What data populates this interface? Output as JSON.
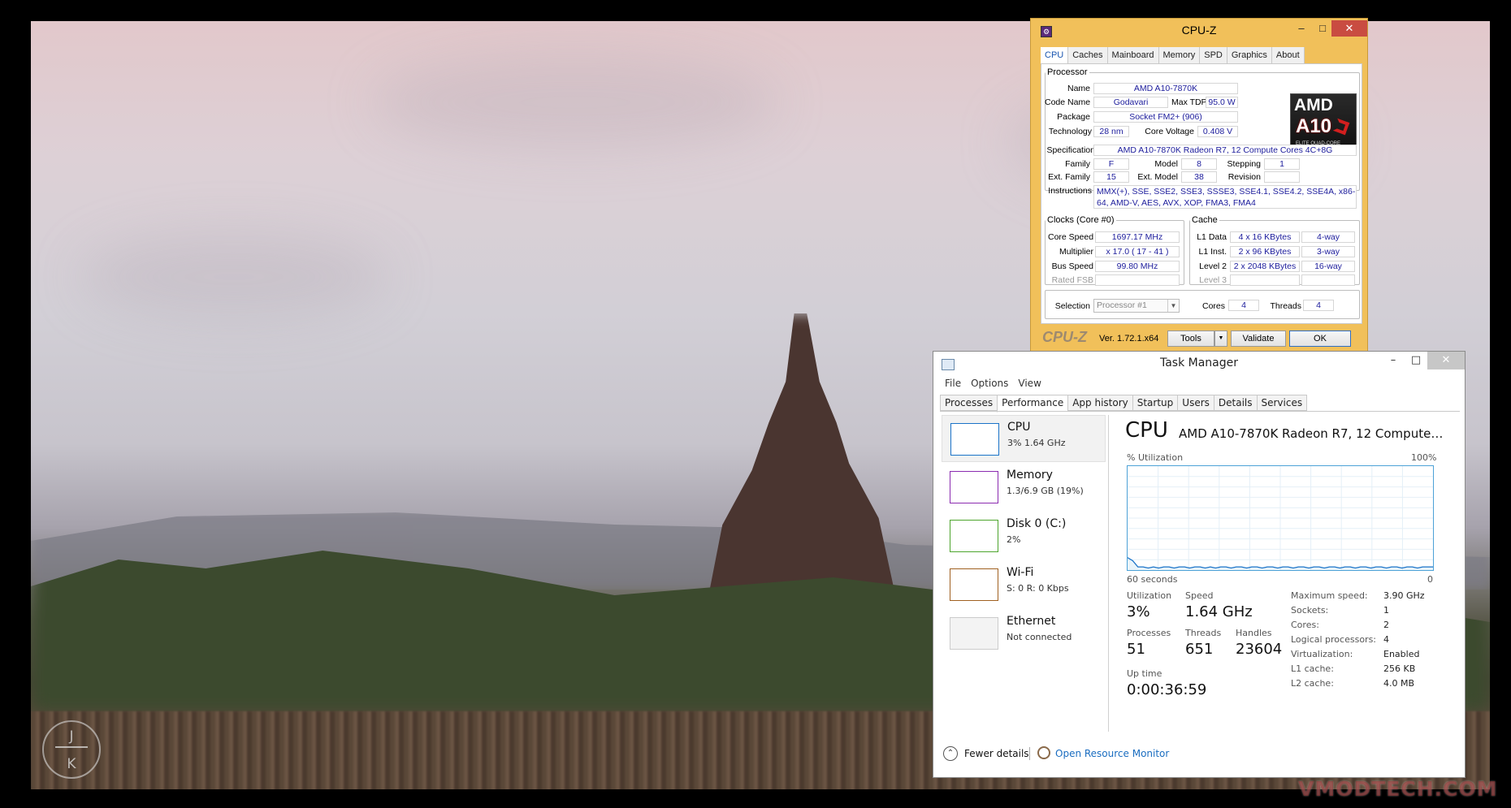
{
  "desktop": {
    "logo_line1": "J",
    "logo_line2": "K",
    "watermark": "VMODTECH.COM"
  },
  "cpuz": {
    "title": "CPU-Z",
    "window_controls": {
      "minimize": "–",
      "maximize": "□",
      "close": "✕"
    },
    "tabs": [
      "CPU",
      "Caches",
      "Mainboard",
      "Memory",
      "SPD",
      "Graphics",
      "About"
    ],
    "active_tab": "CPU",
    "processor": {
      "legend": "Processor",
      "name_label": "Name",
      "name": "AMD A10-7870K",
      "codename_label": "Code Name",
      "codename": "Godavari",
      "maxtdp_label": "Max TDP",
      "maxtdp": "95.0 W",
      "package_label": "Package",
      "package": "Socket FM2+ (906)",
      "technology_label": "Technology",
      "technology": "28 nm",
      "corevoltage_label": "Core Voltage",
      "corevoltage": "0.408 V",
      "specification_label": "Specification",
      "specification": "AMD A10-7870K Radeon R7, 12 Compute Cores 4C+8G",
      "family_label": "Family",
      "family": "F",
      "model_label": "Model",
      "model": "8",
      "stepping_label": "Stepping",
      "stepping": "1",
      "extfamily_label": "Ext. Family",
      "extfamily": "15",
      "extmodel_label": "Ext. Model",
      "extmodel": "38",
      "revision_label": "Revision",
      "revision": "",
      "instructions_label": "Instructions",
      "instructions": "MMX(+), SSE, SSE2, SSE3, SSSE3, SSE4.1, SSE4.2, SSE4A, x86-64, AMD-V, AES, AVX, XOP, FMA3, FMA4"
    },
    "amd_logo": {
      "brand": "AMD",
      "model": "A10",
      "sub": "ELITE QUAD-CORE"
    },
    "clocks": {
      "legend": "Clocks (Core #0)",
      "corespeed_label": "Core Speed",
      "corespeed": "1697.17 MHz",
      "multiplier_label": "Multiplier",
      "multiplier": "x 17.0 ( 17 - 41 )",
      "busspeed_label": "Bus Speed",
      "busspeed": "99.80 MHz",
      "ratedfsb_label": "Rated FSB",
      "ratedfsb": ""
    },
    "cache": {
      "legend": "Cache",
      "l1data_label": "L1 Data",
      "l1data": "4 x 16 KBytes",
      "l1data_way": "4-way",
      "l1inst_label": "L1 Inst.",
      "l1inst": "2 x 96 KBytes",
      "l1inst_way": "3-way",
      "level2_label": "Level 2",
      "level2": "2 x 2048 KBytes",
      "level2_way": "16-way",
      "level3_label": "Level 3",
      "level3": "",
      "level3_way": ""
    },
    "selection": {
      "selection_label": "Selection",
      "selection": "Processor #1",
      "cores_label": "Cores",
      "cores": "4",
      "threads_label": "Threads",
      "threads": "4"
    },
    "footer": {
      "brand": "CPU-Z",
      "version": "Ver. 1.72.1.x64",
      "tools": "Tools",
      "tools_arrow": "▼",
      "validate": "Validate",
      "ok": "OK"
    }
  },
  "taskmanager": {
    "title": "Task Manager",
    "window_controls": {
      "minimize": "–",
      "maximize": "□",
      "close": "✕"
    },
    "menu": [
      "File",
      "Options",
      "View"
    ],
    "tabs": [
      "Processes",
      "Performance",
      "App history",
      "Startup",
      "Users",
      "Details",
      "Services"
    ],
    "active_tab": "Performance",
    "sidebar": [
      {
        "name": "CPU",
        "sub": "3%  1.64 GHz",
        "color": "#1a73c8"
      },
      {
        "name": "Memory",
        "sub": "1.3/6.9 GB (19%)",
        "color": "#8b2bb0"
      },
      {
        "name": "Disk 0 (C:)",
        "sub": "2%",
        "color": "#4da52d"
      },
      {
        "name": "Wi-Fi",
        "sub": "S: 0  R: 0 Kbps",
        "color": "#a06020"
      },
      {
        "name": "Ethernet",
        "sub": "Not connected",
        "color": "#999999"
      }
    ],
    "cpu": {
      "title": "CPU",
      "model": "AMD A10-7870K Radeon R7, 12 Compute C...",
      "util_label": "% Utilization",
      "util_max": "100%",
      "x_left": "60 seconds",
      "x_right": "0",
      "utilization_label": "Utilization",
      "utilization": "3%",
      "speed_label": "Speed",
      "speed": "1.64 GHz",
      "processes_label": "Processes",
      "processes": "51",
      "threads_label": "Threads",
      "threads": "651",
      "handles_label": "Handles",
      "handles": "23604",
      "uptime_label": "Up time",
      "uptime": "0:00:36:59",
      "details": [
        {
          "k": "Maximum speed:",
          "v": "3.90 GHz"
        },
        {
          "k": "Sockets:",
          "v": "1"
        },
        {
          "k": "Cores:",
          "v": "2"
        },
        {
          "k": "Logical processors:",
          "v": "4"
        },
        {
          "k": "Virtualization:",
          "v": "Enabled"
        },
        {
          "k": "L1 cache:",
          "v": "256 KB"
        },
        {
          "k": "L2 cache:",
          "v": "4.0 MB"
        }
      ]
    },
    "graph_values": [
      12,
      9,
      3,
      3,
      2,
      3,
      2,
      3,
      3,
      2,
      3,
      3,
      2,
      3,
      3,
      2,
      3,
      2,
      3,
      3,
      2,
      3,
      3,
      2,
      3,
      3,
      2,
      3,
      3,
      2,
      3,
      3,
      2,
      3,
      3,
      2,
      3,
      3,
      2,
      3,
      3,
      2,
      3,
      3,
      2,
      3,
      3,
      2,
      3,
      3,
      2,
      3,
      3,
      2,
      3,
      3,
      2,
      3,
      3,
      3
    ],
    "footer": {
      "fewer_details": "Fewer details",
      "resource_monitor": "Open Resource Monitor"
    }
  }
}
